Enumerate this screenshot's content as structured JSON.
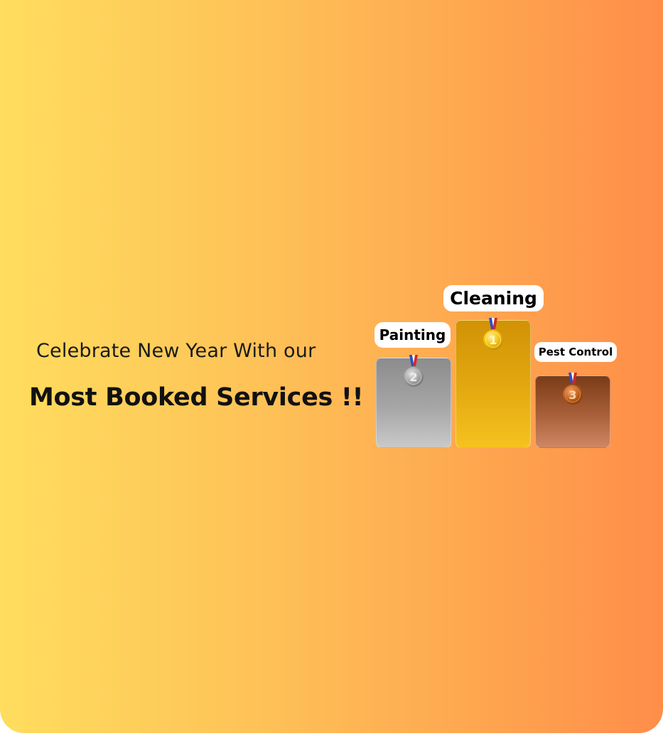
{
  "headline": {
    "subtitle": "Celebrate New Year With our",
    "title": "Most Booked Services !!"
  },
  "podium": {
    "first": {
      "label": "Cleaning",
      "rank": "1"
    },
    "second": {
      "label": "Painting",
      "rank": "2"
    },
    "third": {
      "label": "Pest Control",
      "rank": "3"
    }
  },
  "colors": {
    "gradient_left": "#ffdd5e",
    "gradient_right": "#ff8d49",
    "gold": "#f0b411",
    "silver": "#a0a0a0",
    "bronze": "#a9603a"
  },
  "icons": [
    "gold-medal-icon",
    "silver-medal-icon",
    "bronze-medal-icon"
  ]
}
